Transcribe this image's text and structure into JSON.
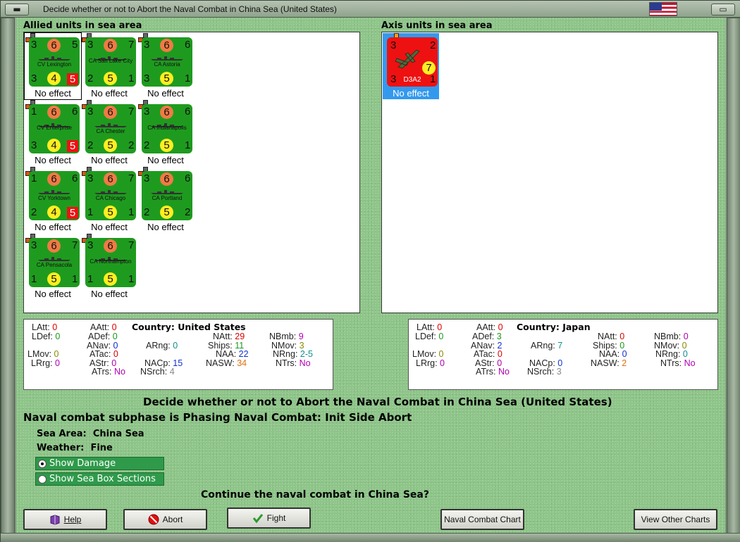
{
  "window": {
    "title": "Decide whether or not to Abort the Naval Combat in China Sea (United States)",
    "flag_icon": "us-flag-icon"
  },
  "allied": {
    "label": "Allied units in sea area",
    "units": [
      {
        "name": "CV Lexington",
        "tl": "3",
        "attack": "6",
        "tr": "5",
        "bl": "3",
        "defense": "4",
        "br": "5",
        "br_badge": true,
        "effect": "No effect"
      },
      {
        "name": "CA Salt Lake City",
        "tl": "3",
        "attack": "6",
        "tr": "7",
        "bl": "2",
        "defense": "5",
        "br": "1",
        "br_badge": false,
        "effect": "No effect"
      },
      {
        "name": "CA Astoria",
        "tl": "3",
        "attack": "6",
        "tr": "6",
        "bl": "3",
        "defense": "5",
        "br": "1",
        "br_badge": false,
        "effect": "No effect"
      },
      {
        "name": "CV Enterprise",
        "tl": "1",
        "attack": "6",
        "tr": "6",
        "bl": "3",
        "defense": "4",
        "br": "5",
        "br_badge": true,
        "effect": "No effect"
      },
      {
        "name": "CA Chester",
        "tl": "3",
        "attack": "6",
        "tr": "7",
        "bl": "2",
        "defense": "5",
        "br": "2",
        "br_badge": false,
        "effect": "No effect"
      },
      {
        "name": "CA Indianapolis",
        "tl": "3",
        "attack": "6",
        "tr": "6",
        "bl": "2",
        "defense": "5",
        "br": "1",
        "br_badge": false,
        "effect": "No effect"
      },
      {
        "name": "CV Yorktown",
        "tl": "1",
        "attack": "6",
        "tr": "6",
        "bl": "2",
        "defense": "4",
        "br": "5",
        "br_badge": true,
        "effect": "No effect"
      },
      {
        "name": "CA Chicago",
        "tl": "3",
        "attack": "6",
        "tr": "7",
        "bl": "1",
        "defense": "5",
        "br": "1",
        "br_badge": false,
        "effect": "No effect"
      },
      {
        "name": "CA Portland",
        "tl": "3",
        "attack": "6",
        "tr": "6",
        "bl": "2",
        "defense": "5",
        "br": "2",
        "br_badge": false,
        "effect": "No effect"
      },
      {
        "name": "CA Pensacola",
        "tl": "3",
        "attack": "6",
        "tr": "7",
        "bl": "1",
        "defense": "5",
        "br": "1",
        "br_badge": false,
        "effect": "No effect"
      },
      {
        "name": "CA Northampton",
        "tl": "3",
        "attack": "6",
        "tr": "7",
        "bl": "1",
        "defense": "5",
        "br": "1",
        "br_badge": false,
        "effect": "No effect"
      }
    ],
    "stats": {
      "country_label": "Country:",
      "country": "United States",
      "LAtt": "0",
      "LDef": "0",
      "LMov": "0",
      "LRrg": "0",
      "AAtt": "0",
      "ADef": "0",
      "ANav": "0",
      "ATac": "0",
      "AStr": "0",
      "ATrs": "No",
      "ARng": "0",
      "NACp": "15",
      "NSrch": "4",
      "NAtt": "29",
      "Ships": "11",
      "NAA": "22",
      "NASW": "34",
      "NBmb": "9",
      "NMov": "3",
      "NRng": "2-5",
      "NTrs": "No"
    }
  },
  "axis": {
    "label": "Axis units in sea area",
    "units": [
      {
        "name": "D3A2",
        "tl": "3",
        "tr": "2",
        "bl": "3",
        "br": "1",
        "attack": "7",
        "effect": "No effect"
      }
    ],
    "stats": {
      "country_label": "Country:",
      "country": "Japan",
      "LAtt": "0",
      "LDef": "0",
      "LMov": "0",
      "LRrg": "0",
      "AAtt": "0",
      "ADef": "3",
      "ANav": "2",
      "ATac": "0",
      "AStr": "0",
      "ATrs": "No",
      "ARng": "7",
      "NACp": "0",
      "NSrch": "3",
      "NAtt": "0",
      "Ships": "0",
      "NAA": "0",
      "NASW": "2",
      "NBmb": "0",
      "NMov": "0",
      "NRng": "0",
      "NTrs": "No"
    }
  },
  "main": {
    "heading": "Decide whether or not to Abort the Naval Combat in China Sea (United States)",
    "subphase": "Naval combat subphase is Phasing Naval Combat: Init Side Abort",
    "sea_area_label": "Sea Area:",
    "sea_area": "China Sea",
    "weather_label": "Weather:",
    "weather": "Fine",
    "show_damage": "Show Damage",
    "show_sea_box": "Show Sea Box Sections",
    "question": "Continue the naval combat in China Sea?"
  },
  "buttons": {
    "help": "Help",
    "abort": "Abort",
    "fight": "Fight",
    "naval_chart": "Naval Combat Chart",
    "other_charts": "View Other Charts"
  },
  "colors": {
    "background": "#8fc48a",
    "allied_counter": "#1e9b1e",
    "axis_counter": "#ee1111",
    "red_values": "#dd0000",
    "green_values": "#1a9a1a",
    "blue_values": "#1030d0",
    "orange_values": "#e07010",
    "purple_values": "#b000b0",
    "olive_values": "#8a8a00",
    "teal_values": "#109090",
    "gray_values": "#888888"
  }
}
